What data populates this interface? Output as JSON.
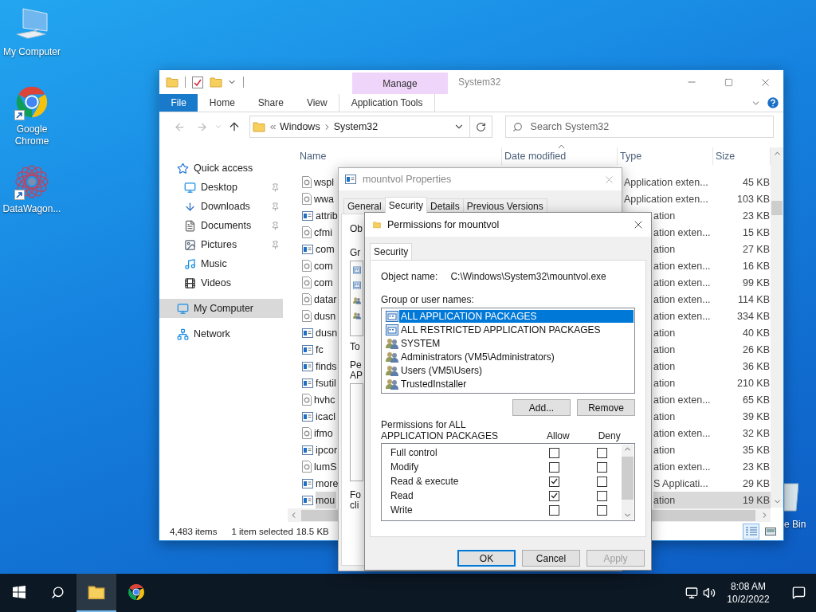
{
  "desktop": {
    "icons": [
      {
        "label": "My Computer",
        "kind": "computer",
        "shortcut": false
      },
      {
        "label": "Google Chrome",
        "kind": "chrome",
        "shortcut": true
      },
      {
        "label": "DataWagon...",
        "kind": "datawagon",
        "shortcut": true
      }
    ],
    "recycle_bin": {
      "label": "e Bin"
    }
  },
  "explorer": {
    "title": "System32",
    "context_tab": "Manage",
    "ribbon_tabs": [
      {
        "label": "File",
        "kind": "file"
      },
      {
        "label": "Home",
        "kind": "plain"
      },
      {
        "label": "Share",
        "kind": "plain"
      },
      {
        "label": "View",
        "kind": "plain"
      },
      {
        "label": "Application Tools",
        "kind": "context"
      }
    ],
    "address": [
      "Windows",
      "System32"
    ],
    "search": {
      "placeholder": "Search System32"
    },
    "sidebar": [
      {
        "label": "Quick access",
        "pinned": false,
        "selected": false,
        "children": [
          {
            "label": "Desktop",
            "pinned": true,
            "selected": false
          },
          {
            "label": "Downloads",
            "pinned": true,
            "selected": false
          },
          {
            "label": "Documents",
            "pinned": true,
            "selected": false
          },
          {
            "label": "Pictures",
            "pinned": true,
            "selected": false
          },
          {
            "label": "Music",
            "pinned": false,
            "selected": false
          },
          {
            "label": "Videos",
            "pinned": false,
            "selected": false
          }
        ]
      },
      {
        "label": "My Computer",
        "pinned": false,
        "selected": true
      },
      {
        "label": "Network",
        "pinned": false,
        "selected": false
      }
    ],
    "columns": [
      {
        "label": "Name",
        "sorted": false
      },
      {
        "label": "Date modified",
        "sorted": true
      },
      {
        "label": "Type",
        "sorted": false
      },
      {
        "label": "Size",
        "sorted": false
      }
    ],
    "rows": [
      {
        "name": "wspl",
        "kind": "dll",
        "type": "Application exten...",
        "size": "45 KB",
        "selected": false
      },
      {
        "name": "wwa",
        "kind": "dll",
        "type": "Application exten...",
        "size": "103 KB",
        "selected": false
      },
      {
        "name": "attrib",
        "kind": "app",
        "type": "ation",
        "size": "23 KB",
        "selected": false
      },
      {
        "name": "cfmi",
        "kind": "dll",
        "type": "ation exten...",
        "size": "15 KB",
        "selected": false
      },
      {
        "name": "com",
        "kind": "app",
        "type": "ation",
        "size": "27 KB",
        "selected": false
      },
      {
        "name": "com",
        "kind": "dll",
        "type": "ation exten...",
        "size": "16 KB",
        "selected": false
      },
      {
        "name": "com",
        "kind": "dll",
        "type": "ation exten...",
        "size": "99 KB",
        "selected": false
      },
      {
        "name": "datar",
        "kind": "dll",
        "type": "ation exten...",
        "size": "114 KB",
        "selected": false
      },
      {
        "name": "dusn",
        "kind": "dll",
        "type": "ation exten...",
        "size": "334 KB",
        "selected": false
      },
      {
        "name": "dusn",
        "kind": "app",
        "type": "ation",
        "size": "40 KB",
        "selected": false
      },
      {
        "name": "fc",
        "kind": "app",
        "type": "ation",
        "size": "26 KB",
        "selected": false
      },
      {
        "name": "finds",
        "kind": "app",
        "type": "ation",
        "size": "36 KB",
        "selected": false
      },
      {
        "name": "fsutil",
        "kind": "app",
        "type": "ation",
        "size": "210 KB",
        "selected": false
      },
      {
        "name": "hvhc",
        "kind": "dll",
        "type": "ation exten...",
        "size": "65 KB",
        "selected": false
      },
      {
        "name": "icacl",
        "kind": "app",
        "type": "ation",
        "size": "39 KB",
        "selected": false
      },
      {
        "name": "ifmo",
        "kind": "dll",
        "type": "ation exten...",
        "size": "32 KB",
        "selected": false
      },
      {
        "name": "ipcor",
        "kind": "app",
        "type": "ation",
        "size": "35 KB",
        "selected": false
      },
      {
        "name": "lumS",
        "kind": "dll",
        "type": "ation exten...",
        "size": "23 KB",
        "selected": false
      },
      {
        "name": "more",
        "kind": "app",
        "type": "S Applicati...",
        "size": "29 KB",
        "selected": false
      },
      {
        "name": "mou",
        "kind": "app",
        "type": "ation",
        "size": "19 KB",
        "selected": true
      }
    ],
    "status": {
      "count": "4,483 items",
      "selection": "1 item selected",
      "size": "18.5 KB"
    },
    "view_buttons": [
      {
        "kind": "details",
        "selected": true
      },
      {
        "kind": "tiles",
        "selected": false
      }
    ]
  },
  "properties": {
    "title": "mountvol Properties",
    "tabs": [
      {
        "label": "General",
        "selected": false
      },
      {
        "label": "Security",
        "selected": true
      },
      {
        "label": "Details",
        "selected": false
      },
      {
        "label": "Previous Versions",
        "selected": false
      }
    ],
    "label_fragments": [
      [
        "Ob"
      ],
      [
        "Gr"
      ],
      [
        "To"
      ],
      [
        "Pe",
        "AP"
      ],
      [
        "Fo",
        "cli"
      ]
    ]
  },
  "permissions": {
    "title": "Permissions for mountvol",
    "tabs": [
      {
        "label": "Security",
        "selected": true
      }
    ],
    "object_label": "Object name:",
    "object_value": "C:\\Windows\\System32\\mountvol.exe",
    "group_label": "Group or user names:",
    "principals": [
      {
        "name": "ALL APPLICATION PACKAGES",
        "kind": "package",
        "selected": true
      },
      {
        "name": "ALL RESTRICTED APPLICATION PACKAGES",
        "kind": "package",
        "selected": false
      },
      {
        "name": "SYSTEM",
        "kind": "group",
        "selected": false
      },
      {
        "name": "Administrators (VM5\\Administrators)",
        "kind": "group",
        "selected": false
      },
      {
        "name": "Users (VM5\\Users)",
        "kind": "group",
        "selected": false
      },
      {
        "name": "TrustedInstaller",
        "kind": "group",
        "selected": false
      }
    ],
    "list_buttons": [
      "Add...",
      "Remove"
    ],
    "permissions_label": "Permissions for ALL APPLICATION PACKAGES",
    "allow_header": "Allow",
    "deny_header": "Deny",
    "entries": [
      {
        "name": "Full control",
        "allow": false,
        "deny": false
      },
      {
        "name": "Modify",
        "allow": false,
        "deny": false
      },
      {
        "name": "Read & execute",
        "allow": true,
        "deny": false
      },
      {
        "name": "Read",
        "allow": true,
        "deny": false
      },
      {
        "name": "Write",
        "allow": false,
        "deny": false
      }
    ],
    "buttons": [
      {
        "label": "OK",
        "default": true,
        "disabled": false
      },
      {
        "label": "Cancel",
        "default": false,
        "disabled": false
      },
      {
        "label": "Apply",
        "default": false,
        "disabled": true
      }
    ]
  },
  "taskbar": {
    "apps": [
      {
        "kind": "explorer",
        "active": true
      },
      {
        "kind": "chrome",
        "active": false
      }
    ],
    "time": "8:08 AM",
    "date": "10/2/2022"
  }
}
